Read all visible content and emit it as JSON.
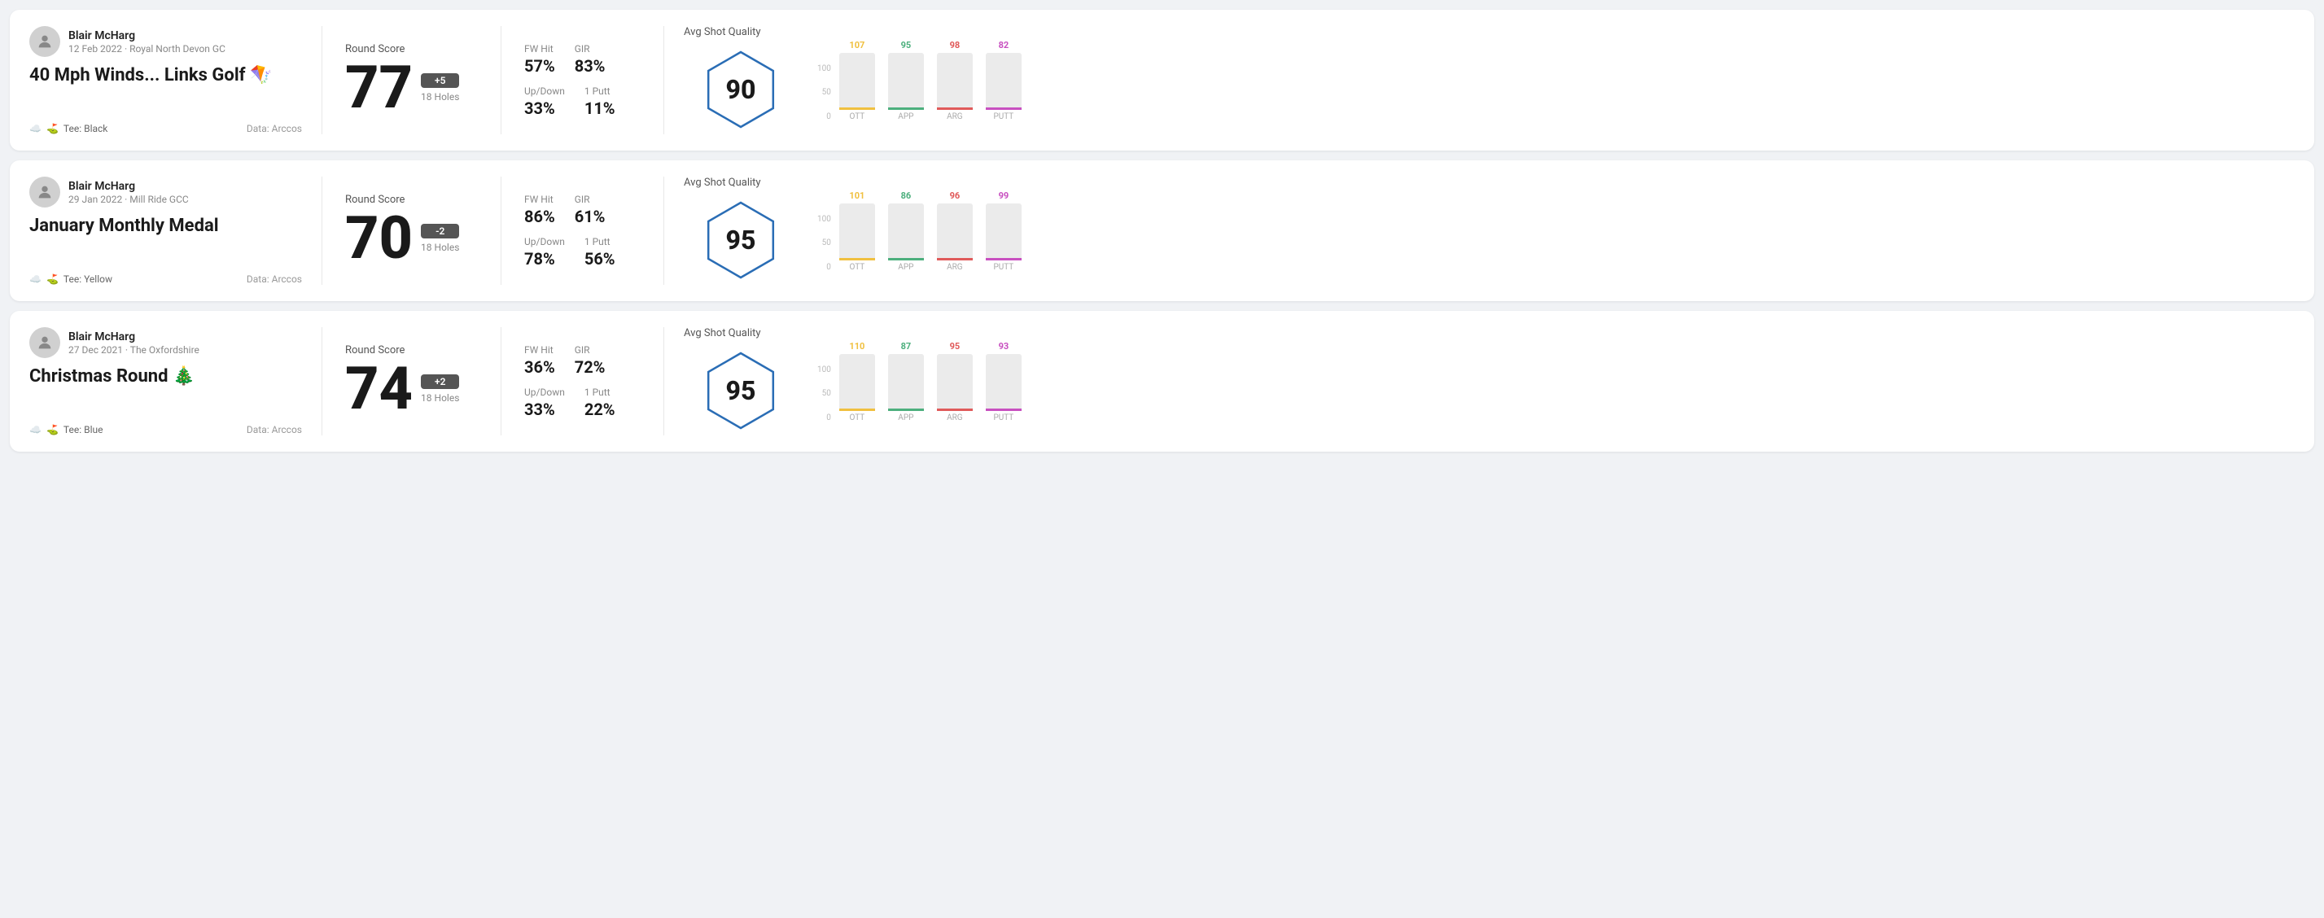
{
  "rounds": [
    {
      "id": "round1",
      "user": {
        "name": "Blair McHarg",
        "date": "12 Feb 2022 · Royal North Devon GC",
        "tee": "Black",
        "data_source": "Data: Arccos"
      },
      "title": "40 Mph Winds... Links Golf 🪁",
      "score": {
        "label": "Round Score",
        "number": "77",
        "badge": "+5",
        "holes": "18 Holes"
      },
      "stats": {
        "fw_hit_label": "FW Hit",
        "fw_hit_value": "57%",
        "gir_label": "GIR",
        "gir_value": "83%",
        "updown_label": "Up/Down",
        "updown_value": "33%",
        "one_putt_label": "1 Putt",
        "one_putt_value": "11%"
      },
      "quality": {
        "label": "Avg Shot Quality",
        "score": "90",
        "bars": [
          {
            "label": "OTT",
            "value": 107,
            "color": "#f0c040"
          },
          {
            "label": "APP",
            "value": 95,
            "color": "#4caf7d"
          },
          {
            "label": "ARG",
            "value": 98,
            "color": "#e05a5a"
          },
          {
            "label": "PUTT",
            "value": 82,
            "color": "#c850c0"
          }
        ]
      }
    },
    {
      "id": "round2",
      "user": {
        "name": "Blair McHarg",
        "date": "29 Jan 2022 · Mill Ride GCC",
        "tee": "Yellow",
        "data_source": "Data: Arccos"
      },
      "title": "January Monthly Medal",
      "score": {
        "label": "Round Score",
        "number": "70",
        "badge": "-2",
        "holes": "18 Holes"
      },
      "stats": {
        "fw_hit_label": "FW Hit",
        "fw_hit_value": "86%",
        "gir_label": "GIR",
        "gir_value": "61%",
        "updown_label": "Up/Down",
        "updown_value": "78%",
        "one_putt_label": "1 Putt",
        "one_putt_value": "56%"
      },
      "quality": {
        "label": "Avg Shot Quality",
        "score": "95",
        "bars": [
          {
            "label": "OTT",
            "value": 101,
            "color": "#f0c040"
          },
          {
            "label": "APP",
            "value": 86,
            "color": "#4caf7d"
          },
          {
            "label": "ARG",
            "value": 96,
            "color": "#e05a5a"
          },
          {
            "label": "PUTT",
            "value": 99,
            "color": "#c850c0"
          }
        ]
      }
    },
    {
      "id": "round3",
      "user": {
        "name": "Blair McHarg",
        "date": "27 Dec 2021 · The Oxfordshire",
        "tee": "Blue",
        "data_source": "Data: Arccos"
      },
      "title": "Christmas Round 🎄",
      "score": {
        "label": "Round Score",
        "number": "74",
        "badge": "+2",
        "holes": "18 Holes"
      },
      "stats": {
        "fw_hit_label": "FW Hit",
        "fw_hit_value": "36%",
        "gir_label": "GIR",
        "gir_value": "72%",
        "updown_label": "Up/Down",
        "updown_value": "33%",
        "one_putt_label": "1 Putt",
        "one_putt_value": "22%"
      },
      "quality": {
        "label": "Avg Shot Quality",
        "score": "95",
        "bars": [
          {
            "label": "OTT",
            "value": 110,
            "color": "#f0c040"
          },
          {
            "label": "APP",
            "value": 87,
            "color": "#4caf7d"
          },
          {
            "label": "ARG",
            "value": 95,
            "color": "#e05a5a"
          },
          {
            "label": "PUTT",
            "value": 93,
            "color": "#c850c0"
          }
        ]
      }
    }
  ],
  "y_axis_labels": [
    "100",
    "50",
    "0"
  ]
}
